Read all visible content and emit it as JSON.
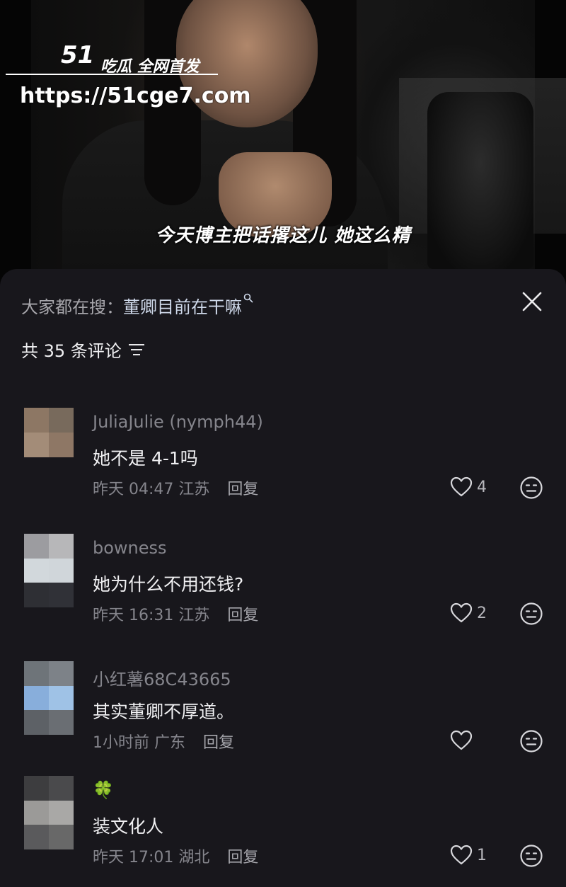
{
  "video": {
    "subtitle": "今天博主把话撂这儿 她这么精",
    "watermark": {
      "brand": "51",
      "tagline": "吃瓜 全网首发",
      "url": "https://51cge7.com"
    }
  },
  "panel": {
    "search_prefix": "大家都在搜：",
    "search_term": "董卿目前在干嘛",
    "count_text": "共 35 条评论",
    "colors": {
      "background": "#18171c",
      "text_primary": "#f0f0f2",
      "text_secondary": "#85858c",
      "search_term": "#cfd9ea"
    }
  },
  "comments": [
    {
      "username": "JuliaJulie (nymph44)",
      "text": "她不是 4-1吗",
      "time": "昨天 04:47",
      "location": "江苏",
      "reply_label": "回复",
      "likes": "4",
      "avatar_colors": [
        "#8d7764",
        "#786a5c",
        "#a38c78",
        "#8e7765"
      ]
    },
    {
      "username": "bowness",
      "text": "她为什么不用还钱?",
      "time": "昨天 16:31",
      "location": "江苏",
      "reply_label": "回复",
      "likes": "2",
      "avatar_colors": [
        "#9c9ca0",
        "#b7b7b9",
        "#d2d8dc",
        "#d0d6da",
        "#2e2f34",
        "#303137"
      ]
    },
    {
      "username": "小红薯68C43665",
      "text": "其实董卿不厚道。",
      "time": "1小时前",
      "location": "广东",
      "reply_label": "回复",
      "likes": "",
      "avatar_colors": [
        "#6e7479",
        "#7d8288",
        "#88aedb",
        "#9fc2e6",
        "#5d6166",
        "#6a6e73"
      ]
    },
    {
      "username": "🍀",
      "text": "装文化人",
      "time": "昨天 17:01",
      "location": "湖北",
      "reply_label": "回复",
      "likes": "1",
      "avatar_colors": [
        "#3d3d3f",
        "#4a4a4c",
        "#9b9a98",
        "#a9a8a6",
        "#5a5a5c",
        "#686868"
      ]
    }
  ],
  "icons": {
    "close": "close-icon",
    "filter": "filter-icon",
    "like": "heart-icon",
    "dislike": "neutral-face-icon",
    "search": "search-icon"
  }
}
